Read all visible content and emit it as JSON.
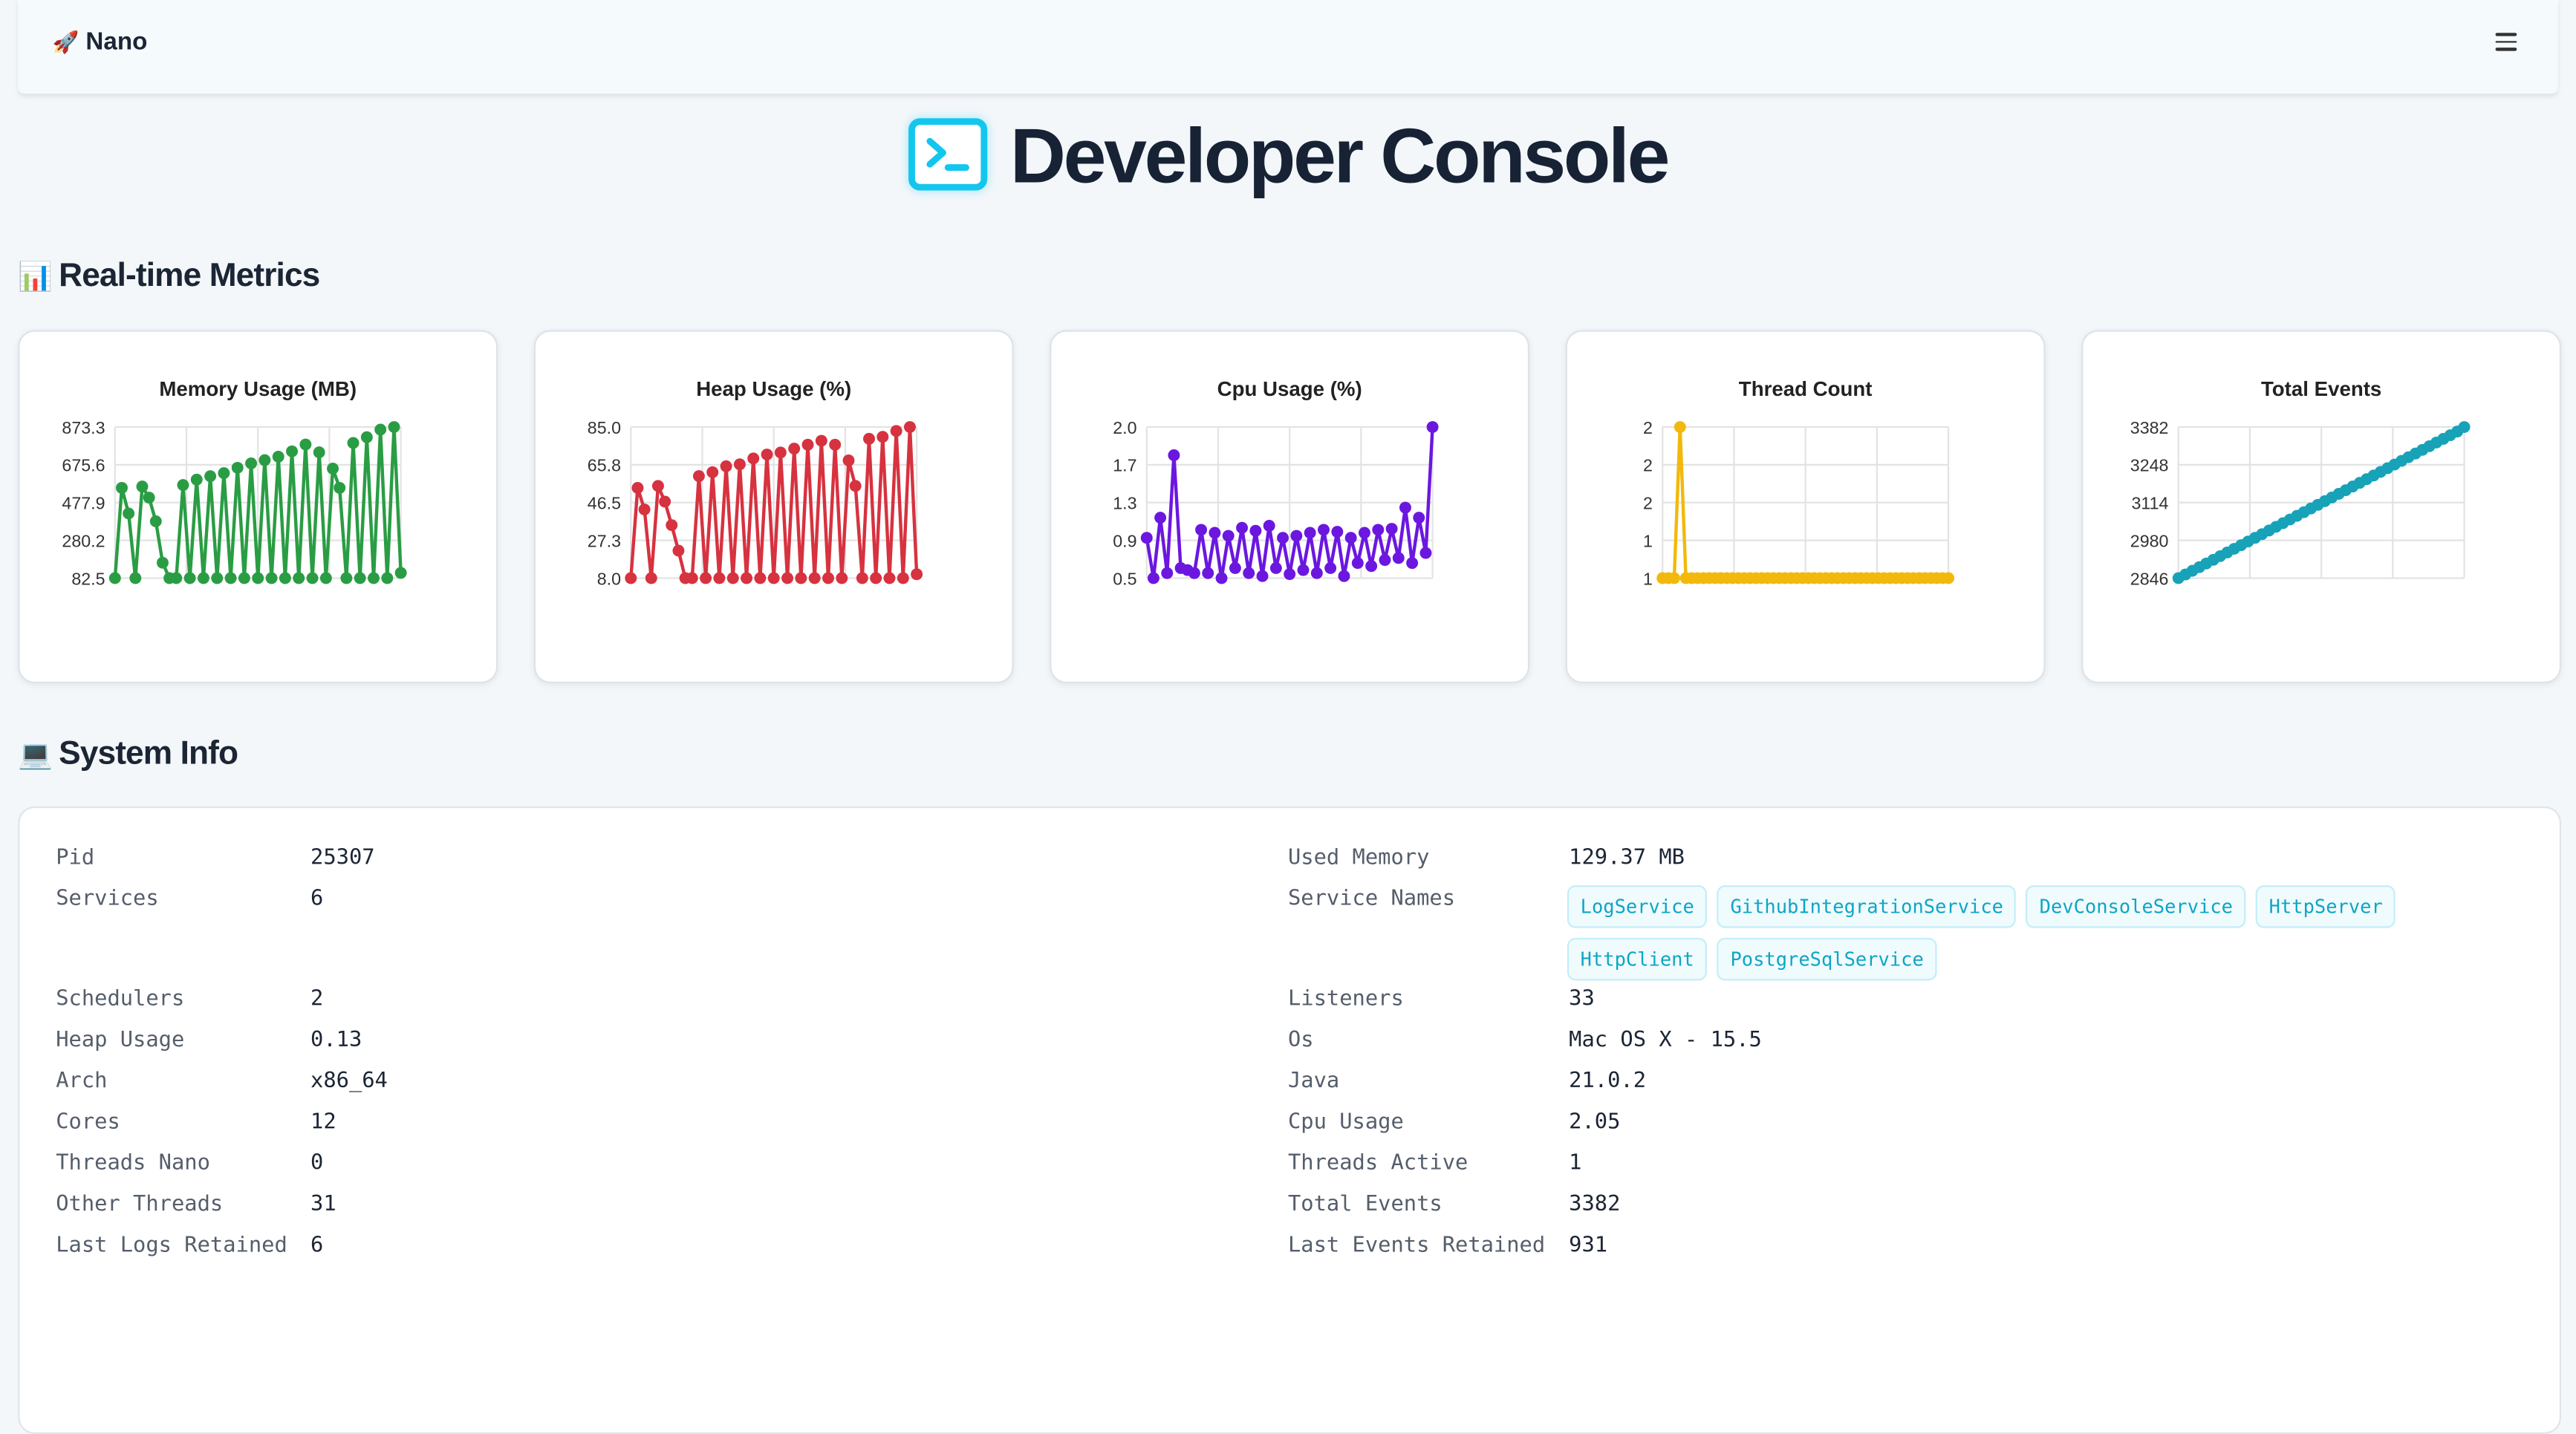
{
  "navbar": {
    "brand_emoji": "🚀",
    "brand": "Nano",
    "menu_icon": "hamburger-icon"
  },
  "hero": {
    "title": "Developer Console",
    "icon": "terminal-icon",
    "accent": "#13c6ee"
  },
  "sections": {
    "metrics_emoji": "📊",
    "metrics_title": "Real-time Metrics",
    "system_emoji": "💻",
    "system_title": "System Info"
  },
  "chart_data": [
    {
      "type": "line",
      "title": "Memory Usage (MB)",
      "color": "#2a9d44",
      "yticks": [
        "873.3",
        "675.6",
        "477.9",
        "280.2",
        "82.5"
      ],
      "ylim": [
        82.5,
        873.3
      ],
      "values": [
        82.5,
        555,
        421,
        82.5,
        562,
        504,
        380,
        163,
        82.5,
        82.5,
        570,
        82.5,
        598,
        82.5,
        616,
        82.5,
        632,
        82.5,
        660,
        82.5,
        683,
        82.5,
        700,
        82.5,
        718,
        82.5,
        746,
        82.5,
        782,
        82.5,
        741,
        82.5,
        656,
        555,
        82.5,
        790,
        82.5,
        820,
        82.5,
        860,
        82.5,
        873.3,
        110
      ]
    },
    {
      "type": "line",
      "title": "Heap Usage (%)",
      "color": "#d7323f",
      "yticks": [
        "85.0",
        "65.8",
        "46.5",
        "27.3",
        "8.0"
      ],
      "ylim": [
        8,
        85
      ],
      "values": [
        8,
        54,
        43,
        8,
        55,
        47,
        35,
        22,
        8,
        8,
        60,
        8,
        62,
        8,
        65,
        8,
        66,
        8,
        69,
        8,
        71,
        8,
        72,
        8,
        74,
        8,
        76,
        8,
        78,
        8,
        76,
        8,
        68,
        55,
        8,
        79,
        8,
        80,
        8,
        83,
        8,
        85,
        10
      ]
    },
    {
      "type": "line",
      "title": "Cpu Usage (%)",
      "color": "#6b17e0",
      "yticks": [
        "2.0",
        "1.7",
        "1.3",
        "0.9",
        "0.5"
      ],
      "ylim": [
        0.5,
        2.0
      ],
      "values": [
        0.9,
        0.5,
        1.1,
        0.55,
        1.72,
        0.6,
        0.58,
        0.55,
        0.98,
        0.55,
        0.95,
        0.5,
        0.92,
        0.6,
        1.0,
        0.55,
        0.97,
        0.52,
        1.02,
        0.6,
        0.9,
        0.54,
        0.92,
        0.58,
        0.95,
        0.55,
        0.98,
        0.6,
        0.96,
        0.52,
        0.9,
        0.65,
        0.95,
        0.62,
        0.98,
        0.68,
        0.99,
        0.7,
        1.2,
        0.65,
        1.1,
        0.75,
        2.0
      ]
    },
    {
      "type": "line",
      "title": "Thread Count",
      "color": "#f2b90c",
      "yticks": [
        "2",
        "2",
        "2",
        "1",
        "1"
      ],
      "ylim": [
        1,
        2
      ],
      "values": [
        1,
        1,
        1,
        2,
        1,
        1,
        1,
        1,
        1,
        1,
        1,
        1,
        1,
        1,
        1,
        1,
        1,
        1,
        1,
        1,
        1,
        1,
        1,
        1,
        1,
        1,
        1,
        1,
        1,
        1,
        1,
        1,
        1,
        1,
        1,
        1,
        1,
        1,
        1,
        1,
        1,
        1,
        1,
        1,
        1,
        1,
        1,
        1,
        1,
        1
      ]
    },
    {
      "type": "line",
      "title": "Total Events",
      "color": "#17a2b8",
      "yticks": [
        "3382",
        "3248",
        "3114",
        "2980",
        "2846"
      ],
      "ylim": [
        2846,
        3382
      ],
      "values": [
        2846,
        2859,
        2872,
        2885,
        2898,
        2911,
        2924,
        2937,
        2950,
        2963,
        2976,
        2989,
        3002,
        3015,
        3028,
        3041,
        3054,
        3067,
        3080,
        3093,
        3106,
        3119,
        3132,
        3145,
        3158,
        3171,
        3184,
        3197,
        3210,
        3223,
        3236,
        3249,
        3262,
        3275,
        3288,
        3301,
        3314,
        3327,
        3340,
        3353,
        3366,
        3382
      ]
    }
  ],
  "system_info": {
    "left": [
      {
        "label": "Pid",
        "value": "25307"
      },
      {
        "label": "Services",
        "value": "6"
      },
      {
        "label": "Schedulers",
        "value": "2"
      },
      {
        "label": "Heap Usage",
        "value": "0.13"
      },
      {
        "label": "Arch",
        "value": "x86_64"
      },
      {
        "label": "Cores",
        "value": "12"
      },
      {
        "label": "Threads Nano",
        "value": "0"
      },
      {
        "label": "Other Threads",
        "value": "31"
      },
      {
        "label": "Last Logs Retained",
        "value": "6"
      }
    ],
    "right": [
      {
        "label": "Used Memory",
        "value": "129.37 MB"
      },
      {
        "label": "Service Names",
        "value": ""
      },
      {
        "label": "Listeners",
        "value": "33"
      },
      {
        "label": "Os",
        "value": "Mac OS X - 15.5"
      },
      {
        "label": "Java",
        "value": "21.0.2"
      },
      {
        "label": "Cpu Usage",
        "value": "2.05"
      },
      {
        "label": "Threads Active",
        "value": "1"
      },
      {
        "label": "Total Events",
        "value": "3382"
      },
      {
        "label": "Last Events Retained",
        "value": "931"
      }
    ],
    "service_names": [
      "LogService",
      "GithubIntegrationService",
      "DevConsoleService",
      "HttpServer",
      "HttpClient",
      "PostgreSqlService"
    ]
  }
}
